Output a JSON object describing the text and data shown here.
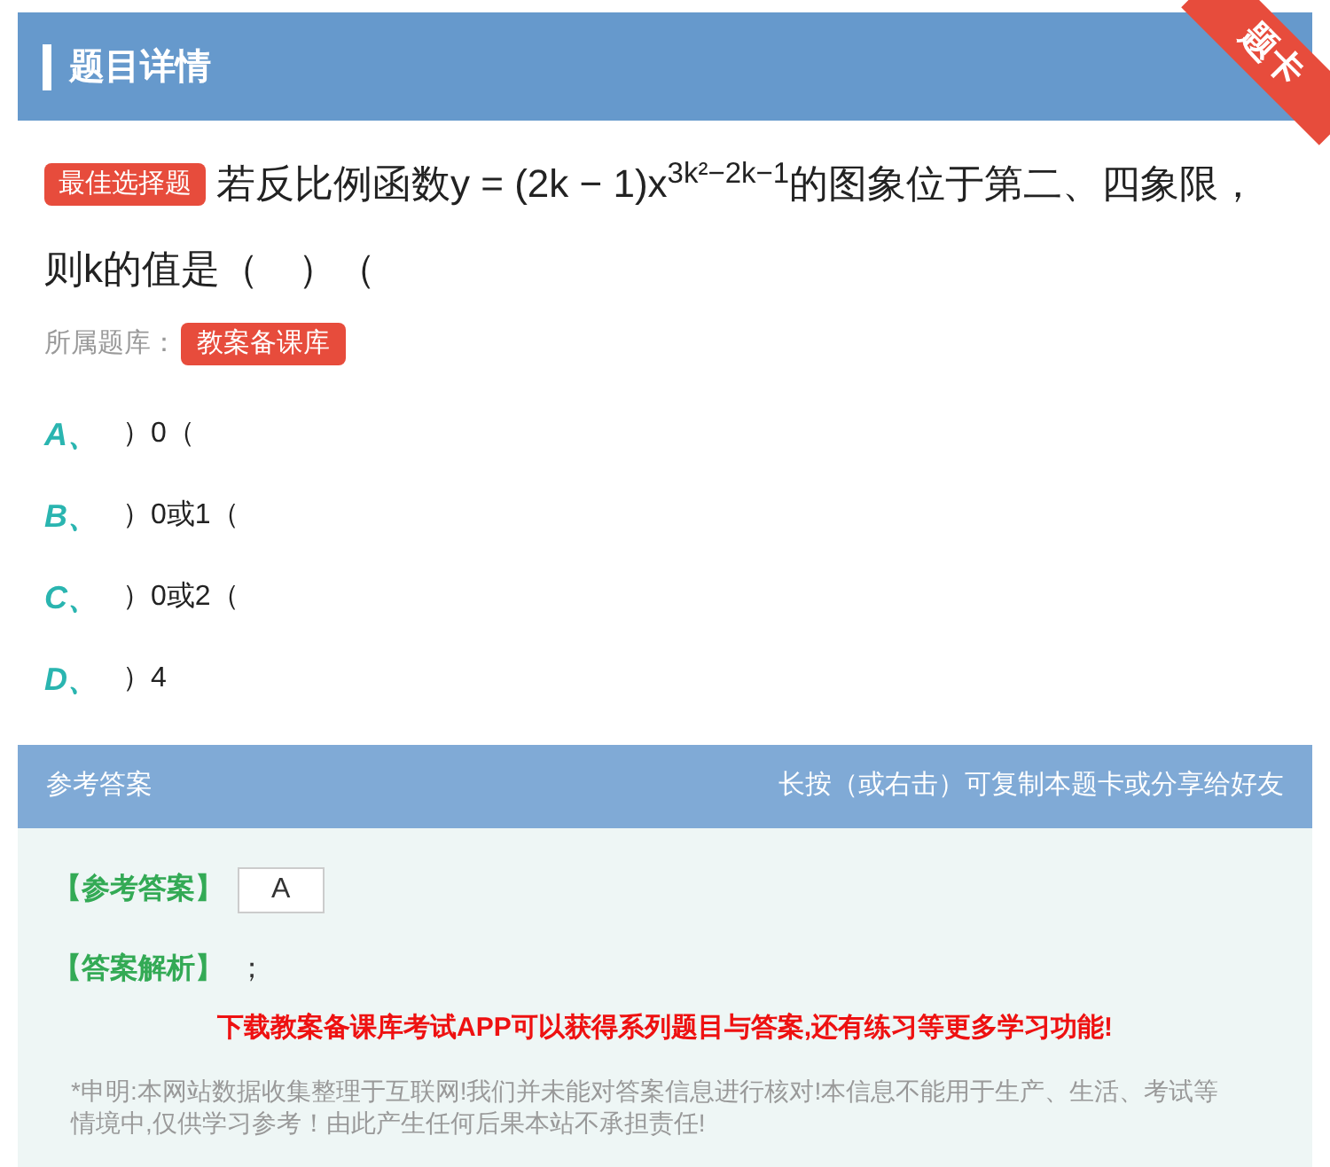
{
  "header": {
    "title": "题目详情",
    "ribbon": "题卡"
  },
  "question": {
    "type_badge": "最佳选择题",
    "text": "若反比例函数y = (2k − 1)x$^{3k²−2k−1}$的图象位于第二、四象限，则k的值是（　）（",
    "bank_label": "所属题库：",
    "bank": "教案备课库"
  },
  "options": [
    {
      "letter": "A、",
      "text": "）0（"
    },
    {
      "letter": "B、",
      "text": "）0或1（"
    },
    {
      "letter": "C、",
      "text": "）0或2（"
    },
    {
      "letter": "D、",
      "text": "）4"
    }
  ],
  "answer": {
    "title": "参考答案",
    "hint": "长按（或右击）可复制本题卡或分享给好友",
    "answer_label": "【参考答案】",
    "answer_value": "A",
    "analysis_label": "【答案解析】",
    "analysis": "；",
    "promo": "下载教案备课库考试APP可以获得系列题目与答案,还有练习等更多学习功能!",
    "disclaimer": "*申明:本网站数据收集整理于互联网!我们并未能对答案信息进行核对!本信息不能用于生产、生活、考试等情境中,仅供学习参考！由此产生任何后果本站不承担责任!"
  }
}
